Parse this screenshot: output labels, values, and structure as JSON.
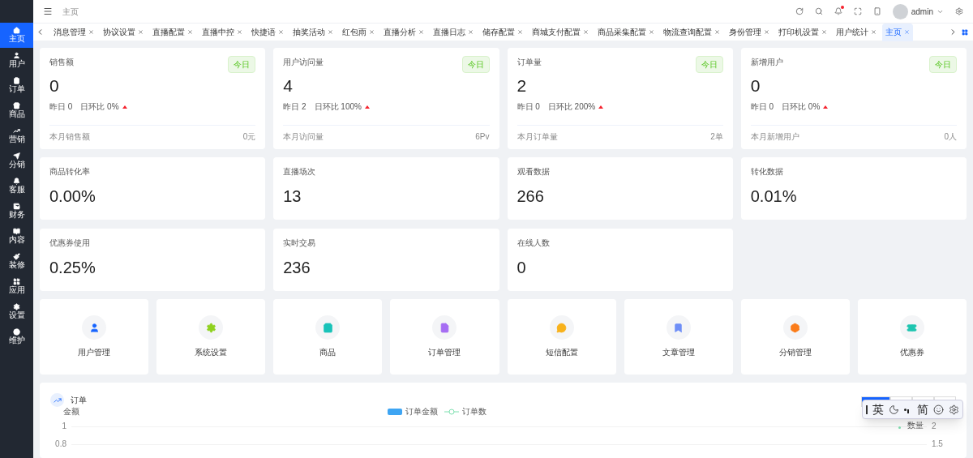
{
  "sidebar": {
    "items": [
      {
        "label": "主页",
        "selected": true
      },
      {
        "label": "用户",
        "selected": false
      },
      {
        "label": "订单",
        "selected": false
      },
      {
        "label": "商品",
        "selected": false
      },
      {
        "label": "营销",
        "selected": false
      },
      {
        "label": "分销",
        "selected": false
      },
      {
        "label": "客服",
        "selected": false
      },
      {
        "label": "财务",
        "selected": false
      },
      {
        "label": "内容",
        "selected": false
      },
      {
        "label": "装修",
        "selected": false
      },
      {
        "label": "应用",
        "selected": false
      },
      {
        "label": "设置",
        "selected": false
      },
      {
        "label": "维护",
        "selected": false
      }
    ]
  },
  "header": {
    "breadcrumb": "主页",
    "user": "admin",
    "notification_dot": true
  },
  "tabs": [
    {
      "label": "消息管理",
      "selected": false
    },
    {
      "label": "协议设置",
      "selected": false
    },
    {
      "label": "直播配置",
      "selected": false
    },
    {
      "label": "直播中控",
      "selected": false
    },
    {
      "label": "快捷语",
      "selected": false
    },
    {
      "label": "抽奖活动",
      "selected": false
    },
    {
      "label": "红包雨",
      "selected": false
    },
    {
      "label": "直播分析",
      "selected": false
    },
    {
      "label": "直播日志",
      "selected": false
    },
    {
      "label": "储存配置",
      "selected": false
    },
    {
      "label": "商城支付配置",
      "selected": false
    },
    {
      "label": "商品采集配置",
      "selected": false
    },
    {
      "label": "物流查询配置",
      "selected": false
    },
    {
      "label": "身份管理",
      "selected": false
    },
    {
      "label": "打印机设置",
      "selected": false
    },
    {
      "label": "用户统计",
      "selected": false
    },
    {
      "label": "主页",
      "selected": true
    }
  ],
  "stat_cards": [
    {
      "title": "销售额",
      "badge": "今日",
      "value": "0",
      "yesterday": "昨日 0",
      "ratio": "日环比 0%",
      "rising": true,
      "footer_label": "本月销售额",
      "footer_value": "0元"
    },
    {
      "title": "用户访问量",
      "badge": "今日",
      "value": "4",
      "yesterday": "昨日 2",
      "ratio": "日环比 100%",
      "rising": true,
      "footer_label": "本月访问量",
      "footer_value": "6Pv"
    },
    {
      "title": "订单量",
      "badge": "今日",
      "value": "2",
      "yesterday": "昨日 0",
      "ratio": "日环比 200%",
      "rising": true,
      "footer_label": "本月订单量",
      "footer_value": "2单"
    },
    {
      "title": "新增用户",
      "badge": "今日",
      "value": "0",
      "yesterday": "昨日 0",
      "ratio": "日环比 0%",
      "rising": true,
      "footer_label": "本月新增用户",
      "footer_value": "0人"
    }
  ],
  "metric_cards": [
    {
      "title": "商品转化率",
      "value": "0.00%"
    },
    {
      "title": "直播场次",
      "value": "13"
    },
    {
      "title": "观看数据",
      "value": "266"
    },
    {
      "title": "转化数据",
      "value": "0.01%"
    },
    {
      "title": "优惠券使用",
      "value": "0.25%"
    },
    {
      "title": "实时交易",
      "value": "236"
    },
    {
      "title": "在线人数",
      "value": "0"
    }
  ],
  "shortcuts": [
    {
      "label": "用户管理",
      "color": "#1664ff"
    },
    {
      "label": "系统设置",
      "color": "#8fd11f"
    },
    {
      "label": "商品",
      "color": "#19c3b9"
    },
    {
      "label": "订单管理",
      "color": "#a66ef3"
    },
    {
      "label": "短信配置",
      "color": "#f8b21c"
    },
    {
      "label": "文章管理",
      "color": "#6f8ff7"
    },
    {
      "label": "分销管理",
      "color": "#fb7c1a"
    },
    {
      "label": "优惠券",
      "color": "#1fc5b0"
    }
  ],
  "order_chart": {
    "title": "订单",
    "left_axis_label": "金额",
    "right_axis_label": "数量",
    "left_ticks": [
      "1",
      "0.8"
    ],
    "right_ticks": [
      "2",
      "1.5"
    ],
    "legend": [
      {
        "label": "订单金额",
        "kind": "bar"
      },
      {
        "label": "订单数",
        "kind": "line"
      }
    ],
    "range_buttons": [
      {
        "selected": true
      },
      {
        "selected": false
      },
      {
        "selected": false
      },
      {
        "selected": false
      }
    ]
  },
  "ime_toolbar": {
    "items": [
      "英",
      "简"
    ]
  }
}
